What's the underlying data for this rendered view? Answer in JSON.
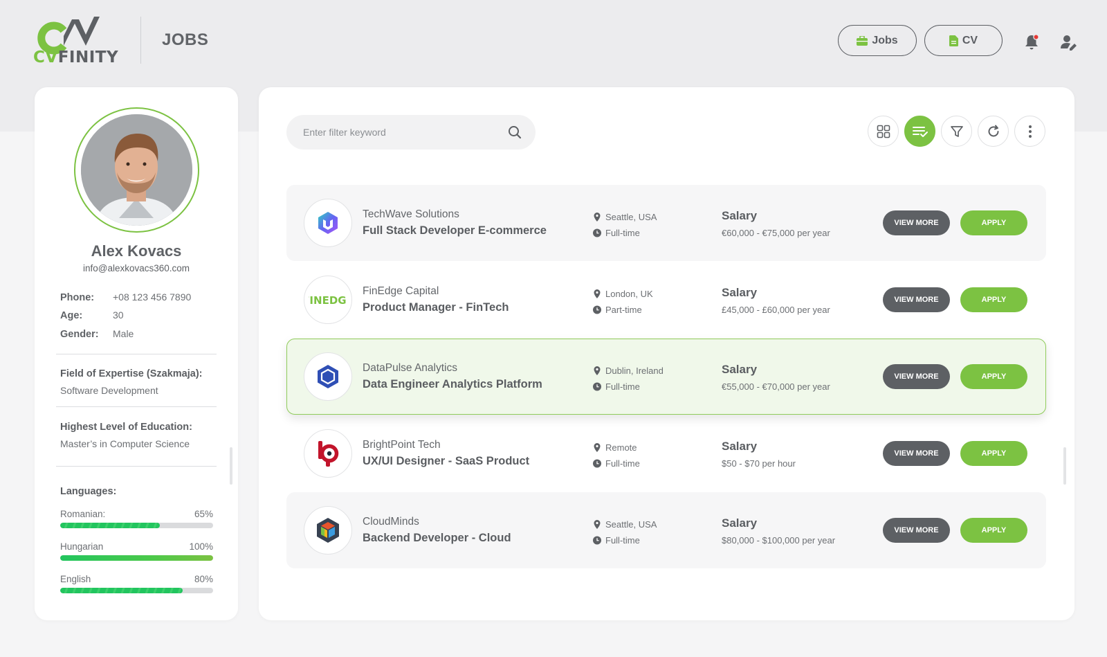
{
  "app": {
    "logo_text_cv": "CV",
    "logo_text_rest": "FINITY",
    "page_title": "JOBS"
  },
  "nav": {
    "jobs_label": "Jobs",
    "cv_label": "CV"
  },
  "colors": {
    "accent": "#7cc242",
    "dark_button": "#5d6064",
    "notification_dot": "#e53935"
  },
  "profile": {
    "name": "Alex Kovacs",
    "email": "info@alexkovacs360.com",
    "fields": [
      {
        "label": "Phone:",
        "value": "+08 123 456 7890"
      },
      {
        "label": "Age:",
        "value": "30"
      },
      {
        "label": "Gender:",
        "value": "Male"
      }
    ],
    "expertise_label": "Field of Expertise (Szakmaja):",
    "expertise_value": "Software Development",
    "education_label": "Highest Level of Education:",
    "education_value": "Master’s in Computer Science",
    "languages_label": "Languages:",
    "languages": [
      {
        "name": "Romanian:",
        "percent_text": "65%",
        "level": 0.65
      },
      {
        "name": "Hungarian",
        "percent_text": "100%",
        "level": 1.0
      },
      {
        "name": "English",
        "percent_text": "80%",
        "level": 0.8
      }
    ]
  },
  "search": {
    "placeholder": "Enter filter keyword"
  },
  "toolbar": {
    "icons": [
      "grid-view-icon",
      "list-view-icon",
      "filter-icon",
      "refresh-icon",
      "more-vertical-icon"
    ],
    "active": "list-view-icon"
  },
  "jobs": [
    {
      "company": "TechWave Solutions",
      "title": "Full Stack Developer E-commerce",
      "location": "Seattle, USA",
      "type": "Full-time",
      "salary_label": "Salary",
      "salary": "€60,000 - €75,000 per year",
      "view_label": "VIEW MORE",
      "apply_label": "APPLY",
      "logo_icon": "techwave-logo-icon"
    },
    {
      "company": "FinEdge Capital",
      "title": "Product Manager - FinTech",
      "location": "London, UK",
      "type": "Part-time",
      "salary_label": "Salary",
      "salary": "£45,000 - £60,000 per year",
      "view_label": "VIEW MORE",
      "apply_label": "APPLY",
      "logo_icon": "finedge-logo-icon",
      "logo_text": "FINEDGE"
    },
    {
      "company": "DataPulse Analytics",
      "title": "Data Engineer Analytics Platform",
      "location": "Dublin, Ireland",
      "type": "Full-time",
      "salary_label": "Salary",
      "salary": "€55,000 - €70,000 per year",
      "view_label": "VIEW MORE",
      "apply_label": "APPLY",
      "logo_icon": "datapulse-logo-icon"
    },
    {
      "company": "BrightPoint Tech",
      "title": "UX/UI Designer - SaaS Product",
      "location": "Remote",
      "type": "Full-time",
      "salary_label": "Salary",
      "salary": "$50 - $70 per hour",
      "view_label": "VIEW MORE",
      "apply_label": "APPLY",
      "logo_icon": "brightpoint-logo-icon"
    },
    {
      "company": "CloudMinds",
      "title": "Backend Developer - Cloud",
      "location": "Seattle, USA",
      "type": "Full-time",
      "salary_label": "Salary",
      "salary": "$80,000 - $100,000 per year",
      "view_label": "VIEW MORE",
      "apply_label": "APPLY",
      "logo_icon": "cloudminds-logo-icon"
    }
  ]
}
